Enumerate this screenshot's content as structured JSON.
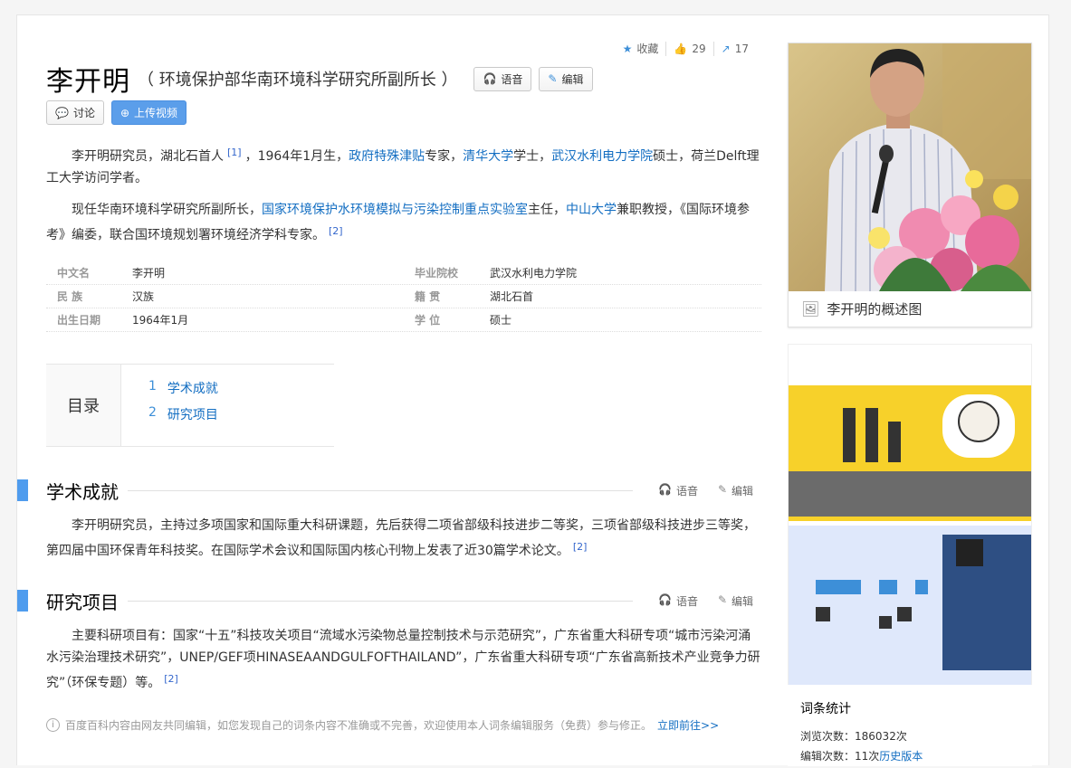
{
  "toolbar": {
    "collect": "收藏",
    "like_count": "29",
    "share_count": "17"
  },
  "title": "李开明",
  "subtitle": "（ 环境保护部华南环境科学研究所副所长 ）",
  "buttons": {
    "voice": "语音",
    "edit": "编辑",
    "discuss": "讨论",
    "upload_video": "上传视频"
  },
  "intro": {
    "p1": {
      "t1": "李开明研究员，湖北石首人",
      "ref1": "[1]",
      "t2": "，1964年1月生，",
      "l1": "政府特殊津贴",
      "t3": "专家，",
      "l2": "清华大学",
      "t4": "学士，",
      "l3": "武汉水利电力学院",
      "t5": "硕士，荷兰Delft理工大学访问学者。"
    },
    "p2": {
      "t1": "现任华南环境科学研究所副所长，",
      "l1": "国家环境保护水环境模拟与污染控制重点实验室",
      "t2": "主任，",
      "l2": "中山大学",
      "t3": "兼职教授，《国际环境参考》编委，联合国环境规划署环境经济学科专家。",
      "ref": "[2]"
    }
  },
  "basic_info": {
    "rows": [
      {
        "k1": "中文名",
        "v1": "李开明",
        "k2": "毕业院校",
        "v2": "武汉水利电力学院"
      },
      {
        "k1": "民 族",
        "v1": "汉族",
        "k2": "籍 贯",
        "v2": "湖北石首"
      },
      {
        "k1": "出生日期",
        "v1": "1964年1月",
        "k2": "学 位",
        "v2": "硕士"
      }
    ]
  },
  "toc": {
    "title": "目录",
    "items": [
      {
        "num": "1",
        "label": "学术成就"
      },
      {
        "num": "2",
        "label": "研究项目"
      }
    ]
  },
  "sections": {
    "s1": {
      "title": "学术成就",
      "text": "李开明研究员，主持过多项国家和国际重大科研课题，先后获得二项省部级科技进步二等奖，三项省部级科技进步三等奖，第四届中国环保青年科技奖。在国际学术会议和国际国内核心刊物上发表了近30篇学术论文。",
      "ref": "[2]"
    },
    "s2": {
      "title": "研究项目",
      "text": "主要科研项目有：国家“十五”科技攻关项目“流域水污染物总量控制技术与示范研究”，广东省重大科研专项“城市污染河涌水污染治理技术研究”，UNEP/GEF项HINASEAANDGULFOFTHAILAND”，广东省重大科研专项“广东省高新技术产业竞争力研究”（环保专题）等。",
      "ref": "[2]"
    }
  },
  "note": {
    "text": "百度百科内容由网友共同编辑，如您发现自己的词条内容不准确或不完善，欢迎使用本人词条编辑服务（免费）参与修正。",
    "link": "立即前往>>"
  },
  "side": {
    "caption": "李开明的概述图",
    "stats_title": "词条统计",
    "views_label": "浏览次数：",
    "views": "186032次",
    "edits_label": "编辑次数：",
    "edits": "11次",
    "history": "历史版本"
  }
}
